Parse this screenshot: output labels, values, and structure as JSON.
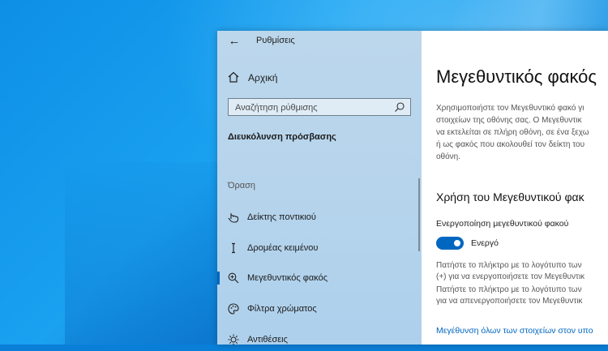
{
  "window": {
    "title": "Ρυθμίσεις"
  },
  "sidebar": {
    "home_label": "Αρχική",
    "search_placeholder": "Αναζήτηση ρύθμισης",
    "section_title": "Διευκόλυνση πρόσβασης",
    "group_label": "Όραση",
    "items": [
      {
        "label": "Δείκτης ποντικιού",
        "icon": "mouse-pointer-icon"
      },
      {
        "label": "Δρομέας κειμένου",
        "icon": "text-cursor-icon"
      },
      {
        "label": "Μεγεθυντικός φακός",
        "icon": "magnifier-icon",
        "selected": true
      },
      {
        "label": "Φίλτρα χρώματος",
        "icon": "palette-icon"
      },
      {
        "label": "Αντιθέσεις",
        "icon": "brightness-icon"
      }
    ]
  },
  "main": {
    "title": "Μεγεθυντικός φακός",
    "description_lines": [
      "Χρησιμοποιήστε τον Μεγεθυντικό φακό γι",
      "στοιχείων της οθόνης σας. Ο Μεγεθυντικ",
      "να εκτελείται σε πλήρη οθόνη, σε ένα ξεχω",
      "ή ως φακός που ακολουθεί τον δείκτη του",
      "οθόνη."
    ],
    "subheading": "Χρήση του Μεγεθυντικού φακ",
    "toggle": {
      "label": "Ενεργοποίηση μεγεθυντικού φακού",
      "state_label": "Ενεργό",
      "on": true
    },
    "info_on_lines": [
      "Πατήστε το πλήκτρο με το λογότυπο των",
      "(+) για να ενεργοποιήσετε τον Μεγεθυντικ"
    ],
    "info_off_lines": [
      "Πατήστε το πλήκτρο με το λογότυπο των",
      "για να απενεργοποιήσετε τον Μεγεθυντικ"
    ],
    "link_label": "Μεγέθυνση όλων των στοιχείων στον υπο"
  },
  "colors": {
    "accent": "#0067c0",
    "sidebar_bg": "#b8d5ec",
    "desktop": "#0d8fe6"
  }
}
